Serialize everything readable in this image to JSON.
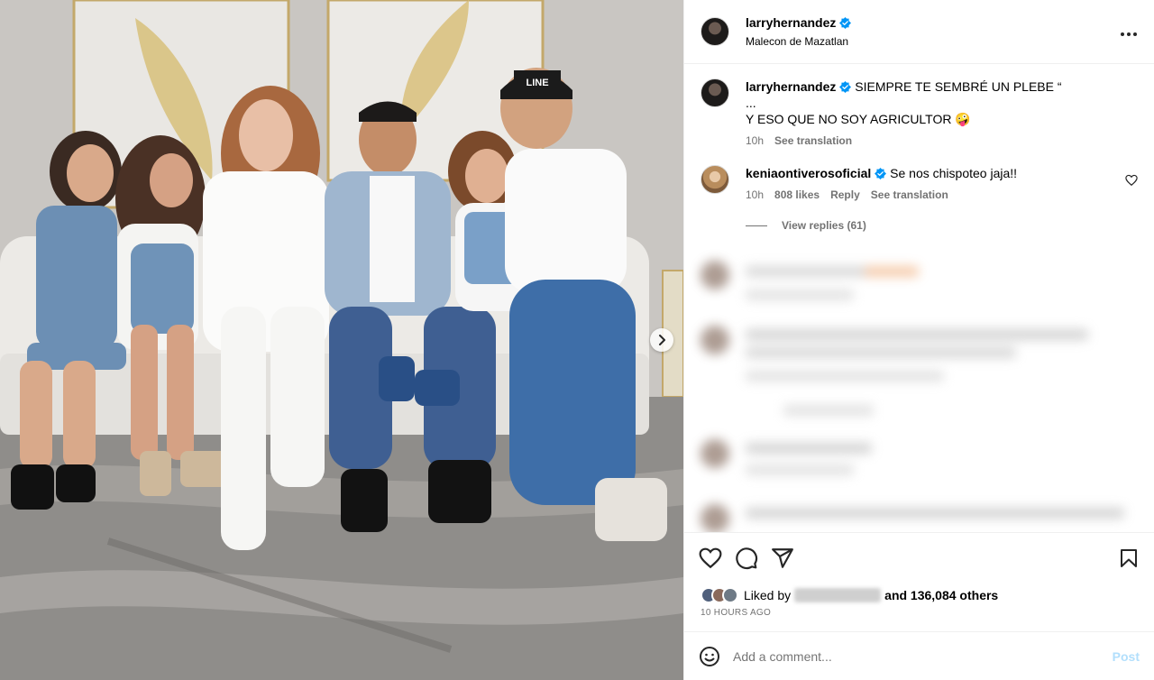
{
  "post": {
    "author": "larryhernandez",
    "location": "Malecon de Mazatlan",
    "verified": true
  },
  "caption": {
    "username": "larryhernandez",
    "line1": "SIEMPRE TE SEMBRÉ UN PLEBE “",
    "line2": "...",
    "line3": "Y ESO QUE NO SOY AGRICULTOR 🤪",
    "time": "10h",
    "see_translation": "See translation"
  },
  "comment": {
    "username": "keniaontiverosoficial",
    "text": "Se nos chispoteo jaja!!",
    "time": "10h",
    "likes": "808 likes",
    "reply": "Reply",
    "see_translation": "See translation",
    "view_replies": "View replies (61)"
  },
  "engagement": {
    "liked_by_prefix": "Liked by",
    "liked_by_suffix": "and 136,084 others",
    "timestamp": "10 HOURS AGO"
  },
  "composer": {
    "placeholder": "Add a comment...",
    "post_label": "Post"
  },
  "icons": {
    "more": "more-options-icon",
    "heart": "heart-icon",
    "comment": "comment-icon",
    "share": "share-icon",
    "save": "bookmark-icon",
    "emoji": "emoji-icon",
    "next": "chevron-right-icon"
  },
  "colors": {
    "verified_blue": "#0095f6",
    "post_disabled": "#b2dffc",
    "muted_text": "#737373"
  }
}
